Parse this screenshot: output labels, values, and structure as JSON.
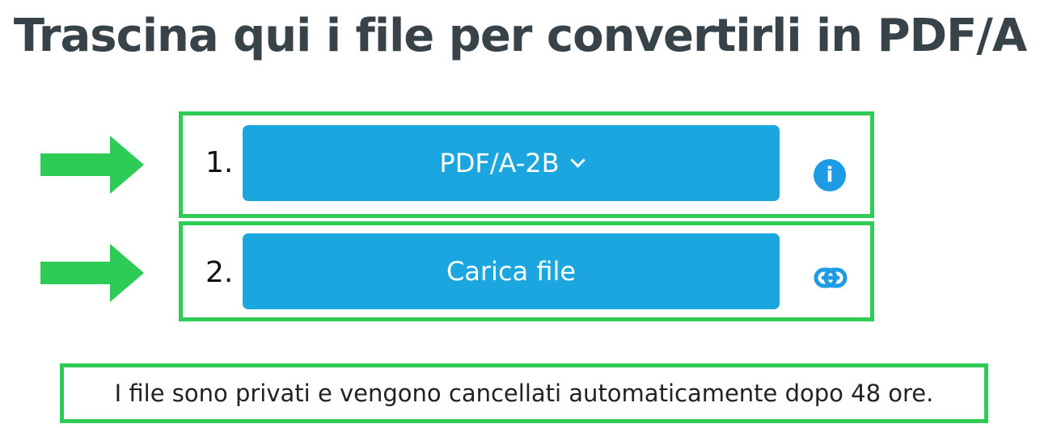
{
  "header": {
    "title": "Trascina qui i file per convertirli in PDF/A"
  },
  "steps": [
    {
      "number": "1.",
      "button_label": "PDF/A-2B",
      "button_icon": "chevron-down-icon",
      "side_icon": "info-icon",
      "side_icon_text": "i"
    },
    {
      "number": "2.",
      "button_label": "Carica file",
      "side_icon": "link-icon"
    }
  ],
  "notice": {
    "text": "I file sono privati e vengono cancellati automaticamente dopo 48 ore."
  },
  "colors": {
    "highlight_green": "#2ecc56",
    "button_blue": "#1ca6e0",
    "title_gray": "#374249"
  }
}
